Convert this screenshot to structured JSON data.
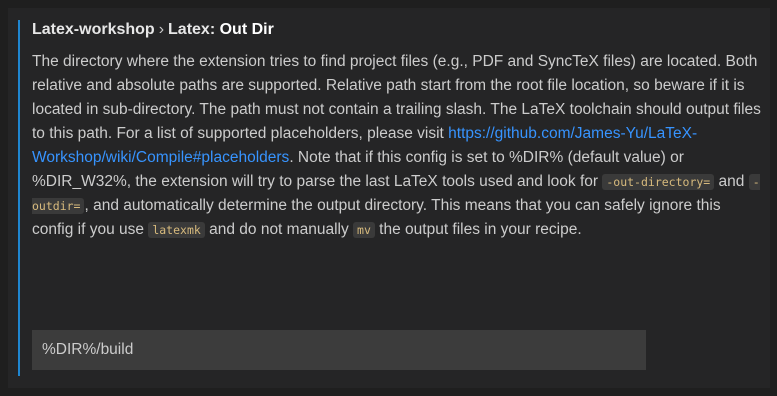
{
  "setting": {
    "category": "Latex-workshop",
    "separator": "›",
    "group": "Latex:",
    "name": "Out Dir",
    "description": {
      "p1": "The directory where the extension tries to find project files (e.g., PDF and SyncTeX files) are located. Both relative and absolute paths are supported. Relative path start from the root file location, so beware if it is located in sub-directory. The path must not contain a trailing slash. The LaTeX toolchain should output files to this path. For a list of supported placeholders, please visit ",
      "link": "https://github.com/James-Yu/LaTeX-Workshop/wiki/Compile#placeholders",
      "p2": ". Note that if this config is set to %DIR% (default value) or %DIR_W32%, the extension will try to parse the last LaTeX tools used and look for ",
      "code1": "-out-directory=",
      "p3": " and ",
      "code2": "-outdir=",
      "p4": ", and automatically determine the output directory. This means that you can safely ignore this config if you use ",
      "code3": "latexmk",
      "p5": " and do not manually ",
      "code4": "mv",
      "p6": " the output files in your recipe."
    },
    "value": "%DIR%/build"
  },
  "colors": {
    "background": "#252526",
    "focus_bar": "#1f86d1",
    "link": "#3794ff",
    "code_text": "#d7ba7d",
    "input_bg": "#3c3c3c"
  }
}
